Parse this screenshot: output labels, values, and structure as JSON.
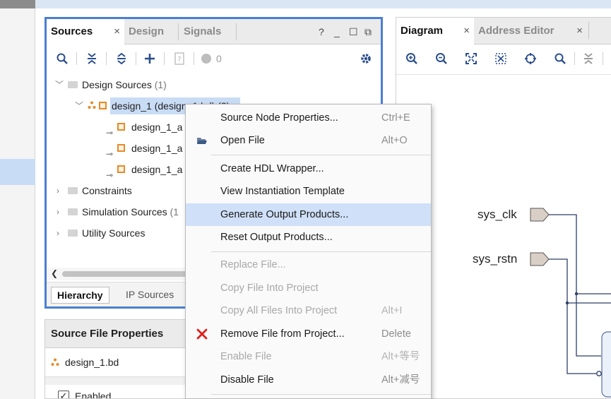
{
  "sources_panel": {
    "tabs": [
      {
        "label": "Sources",
        "close": "×"
      },
      {
        "label": "Design"
      },
      {
        "label": "Signals"
      }
    ],
    "window_controls": {
      "help": "?",
      "minimize": "_",
      "maximize": "☐",
      "float": "⧉"
    },
    "toolbar": {
      "badge_count": "0"
    },
    "tree": {
      "design_sources": {
        "label": "Design Sources",
        "count": "(1)"
      },
      "design_1": {
        "label": "design_1 (design_1.bd) (3)"
      },
      "children": [
        {
          "label": "design_1_a"
        },
        {
          "label": "design_1_a"
        },
        {
          "label": "design_1_a"
        }
      ],
      "constraints": {
        "label": "Constraints"
      },
      "simulation_sources": {
        "label": "Simulation Sources",
        "count": "(1"
      },
      "utility_sources": {
        "label": "Utility Sources"
      }
    },
    "bottom_tabs": [
      {
        "label": "Hierarchy"
      },
      {
        "label": "IP Sources"
      }
    ]
  },
  "props_panel": {
    "title": "Source File Properties",
    "file": "design_1.bd",
    "enabled_label": "Enabled",
    "enabled_check": "✓"
  },
  "diagram_panel": {
    "tabs": [
      {
        "label": "Diagram",
        "close": "×"
      },
      {
        "label": "Address Editor",
        "close": "×"
      }
    ],
    "ports": [
      {
        "label": "sys_clk"
      },
      {
        "label": "sys_rstn"
      }
    ]
  },
  "context_menu": {
    "items": [
      {
        "label": "Source Node Properties...",
        "shortcut": "Ctrl+E"
      },
      {
        "label": "Open File",
        "shortcut": "Alt+O"
      },
      {
        "label": "Create HDL Wrapper..."
      },
      {
        "label": "View Instantiation Template"
      },
      {
        "label": "Generate Output Products..."
      },
      {
        "label": "Reset Output Products..."
      },
      {
        "label": "Replace File..."
      },
      {
        "label": "Copy File Into Project"
      },
      {
        "label": "Copy All Files Into Project",
        "shortcut": "Alt+I"
      },
      {
        "label": "Remove File from Project...",
        "shortcut": "Delete"
      },
      {
        "label": "Enable File",
        "shortcut": "Alt+等号"
      },
      {
        "label": "Disable File",
        "shortcut": "Alt+减号"
      }
    ]
  },
  "colors": {
    "focus_border": "#4a7fd0",
    "selection": "#c9dcf5",
    "menu_highlight": "#cfe0f8",
    "remove_icon": "#e0201b",
    "ip_orange": "#e8892a"
  }
}
